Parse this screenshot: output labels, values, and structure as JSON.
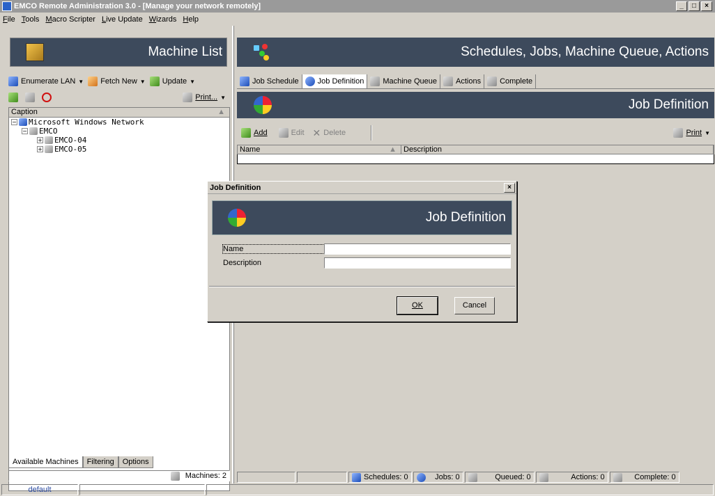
{
  "window": {
    "title": "EMCO Remote Administration 3.0 - [Manage your network remotely]",
    "min_label": "_",
    "max_label": "□",
    "close_label": "×"
  },
  "menu": [
    "File",
    "Tools",
    "Macro Scripter",
    "Live Update",
    "Wizards",
    "Help"
  ],
  "left": {
    "title": "Machine List",
    "toolbar1": {
      "enumerate": "Enumerate LAN",
      "fetch": "Fetch New",
      "update": "Update"
    },
    "toolbar2": {
      "print": "Print..."
    },
    "tree_header": "Caption",
    "tree": [
      {
        "label": "Microsoft Windows Network",
        "level": 0,
        "expander": "−"
      },
      {
        "label": "EMCO",
        "level": 1,
        "expander": "−"
      },
      {
        "label": "EMCO-04",
        "level": 2,
        "expander": "+"
      },
      {
        "label": "EMCO-05",
        "level": 2,
        "expander": "+"
      }
    ],
    "tabs": [
      "Available Machines",
      "Filtering",
      "Options"
    ],
    "status": "Machines: 2"
  },
  "right": {
    "title": "Schedules, Jobs, Machine Queue, Actions",
    "tabs": [
      "Job Schedule",
      "Job Definition",
      "Machine Queue",
      "Actions",
      "Complete"
    ],
    "section_title": "Job Definition",
    "toolbar": {
      "add": "Add",
      "edit": "Edit",
      "delete": "Delete",
      "print": "Print"
    },
    "columns": [
      "Name",
      "Description"
    ],
    "status": {
      "schedules": "Schedules: 0",
      "jobs": "Jobs: 0",
      "queued": "Queued: 0",
      "actions": "Actions: 0",
      "complete": "Complete: 0"
    }
  },
  "bottom_status": {
    "profile": "default"
  },
  "dialog": {
    "title": "Job Definition",
    "close_label": "×",
    "header": "Job Definition",
    "name_label": "Name",
    "name_value": "",
    "description_label": "Description",
    "description_value": "",
    "ok_label": "OK",
    "cancel_label": "Cancel"
  },
  "colors": {
    "header_band": "#3d4a5c",
    "face": "#d4d0c8",
    "titlebar": "#9a9a9a"
  }
}
